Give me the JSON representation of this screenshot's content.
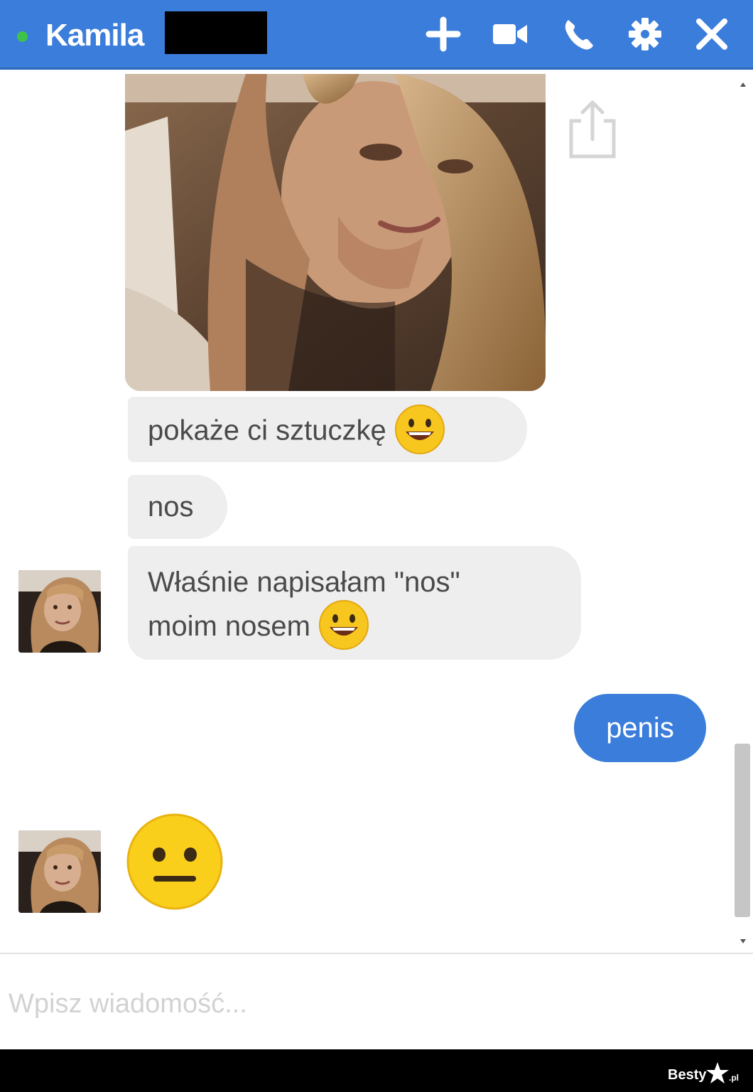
{
  "header": {
    "contact_name": "Kamila",
    "online": true,
    "icons": [
      "add-icon",
      "video-call-icon",
      "phone-icon",
      "gear-icon",
      "close-icon"
    ]
  },
  "messages": [
    {
      "from": "contact",
      "type": "photo",
      "icon": "share-icon"
    },
    {
      "from": "contact",
      "type": "text",
      "text": "pokaże ci sztuczkę",
      "emoji": "grinning-emoji"
    },
    {
      "from": "contact",
      "type": "text",
      "text": "nos"
    },
    {
      "from": "contact",
      "type": "text",
      "lines": [
        "Właśnie napisałam \"nos\"",
        "moim nosem"
      ],
      "emoji": "grinning-emoji"
    },
    {
      "from": "me",
      "type": "text",
      "text": "penis"
    },
    {
      "from": "contact",
      "type": "emoji",
      "emoji": "neutral-face-emoji"
    }
  ],
  "composer": {
    "placeholder": "Wpisz wiadomość..."
  },
  "watermark": {
    "text": "Besty",
    "suffix": ".pl"
  },
  "colors": {
    "accent": "#3b7ddb",
    "incoming_bubble": "#eeeeef",
    "online": "#3fc24a"
  }
}
